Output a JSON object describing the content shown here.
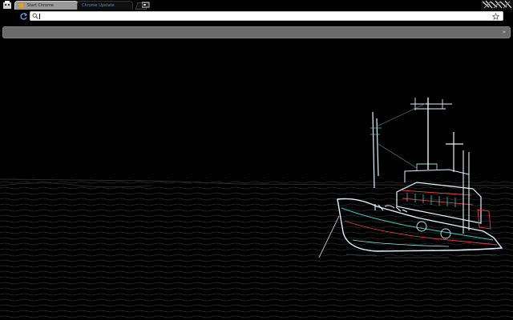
{
  "tabs": [
    {
      "title": "Start Chrome"
    },
    {
      "title": "Chrome Upstate"
    }
  ],
  "omnibox": {
    "value": ""
  },
  "colors": {
    "page_background": "#000000",
    "tab_active": "#9a9a9a",
    "tab_inactive_text": "#4f8fe0",
    "bookmarks_bar": "#6a6a6a",
    "boat_outline": "#dff3ff",
    "boat_accent_red": "#e0404a",
    "boat_accent_teal": "#38c8c0"
  },
  "icons": [
    "app-icon",
    "new-tab-icon",
    "profile-icon",
    "corner-badge-icon",
    "reload-icon",
    "search-icon",
    "star-icon",
    "bookmarks-chevron-icon"
  ]
}
